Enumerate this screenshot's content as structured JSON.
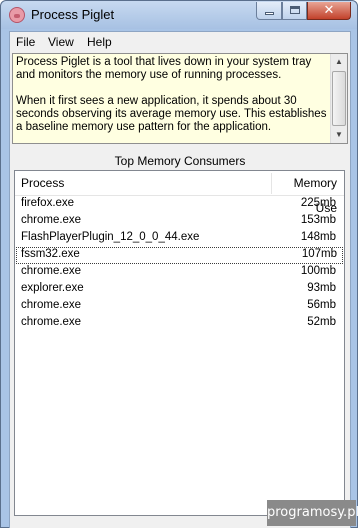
{
  "window": {
    "title": "Process Piglet",
    "controls": {
      "minimize_icon": "minimize-icon",
      "maximize_icon": "maximize-icon",
      "close_glyph": "✕"
    }
  },
  "menu": {
    "items": [
      {
        "label": "File"
      },
      {
        "label": "View"
      },
      {
        "label": "Help"
      }
    ]
  },
  "info": {
    "paragraphs": [
      "Process Piglet is a tool that lives down in your system tray and monitors the memory use of running processes.",
      "When it first sees a new application, it spends about 30 seconds observing its average memory use.  This establishes a baseline memory use pattern for the application."
    ]
  },
  "consumers": {
    "heading": "Top Memory Consumers",
    "columns": {
      "process": "Process",
      "memory": "Memory Use"
    },
    "rows": [
      {
        "process": "firefox.exe",
        "memory": "225mb"
      },
      {
        "process": "chrome.exe",
        "memory": "153mb"
      },
      {
        "process": "FlashPlayerPlugin_12_0_0_44.exe",
        "memory": "148mb"
      },
      {
        "process": "fssm32.exe",
        "memory": "107mb",
        "focused": true
      },
      {
        "process": "chrome.exe",
        "memory": "100mb"
      },
      {
        "process": "explorer.exe",
        "memory": "93mb"
      },
      {
        "process": "chrome.exe",
        "memory": "56mb"
      },
      {
        "process": "chrome.exe",
        "memory": "52mb"
      }
    ]
  },
  "watermark": "programosy.pl"
}
